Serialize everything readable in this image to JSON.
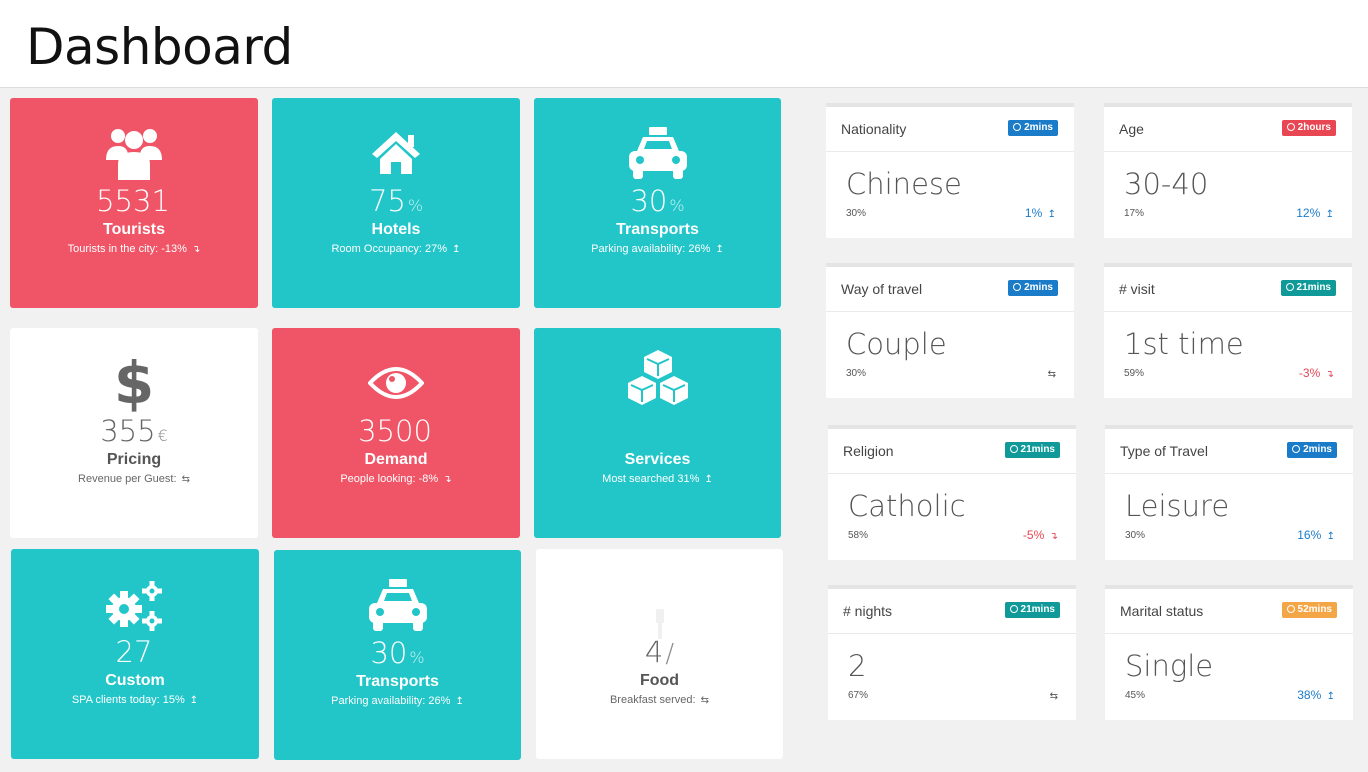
{
  "header": {
    "title": "Dashboard"
  },
  "tiles": [
    {
      "icon": "users-icon",
      "value": "5531",
      "unit": "",
      "label": "Tourists",
      "sub": "Tourists in the city: -13%",
      "trend": "down"
    },
    {
      "icon": "home-icon",
      "value": "75",
      "unit": "%",
      "label": "Hotels",
      "sub": "Room Occupancy: 27%",
      "trend": "up"
    },
    {
      "icon": "taxi-icon",
      "value": "30",
      "unit": "%",
      "label": "Transports",
      "sub": "Parking availability: 26%",
      "trend": "up"
    },
    {
      "icon": "dollar-icon",
      "value": "355",
      "unit": "€",
      "label": "Pricing",
      "sub": "Revenue per Guest:",
      "trend": "neutral"
    },
    {
      "icon": "eye-icon",
      "value": "3500",
      "unit": "",
      "label": "Demand",
      "sub": "People looking: -8%",
      "trend": "down"
    },
    {
      "icon": "cubes-icon",
      "value": "",
      "unit": "",
      "label": "Services",
      "sub": "Most searched 31%",
      "trend": "up"
    },
    {
      "icon": "gears-icon",
      "value": "27",
      "unit": "",
      "label": "Custom",
      "sub": "SPA clients today: 15%",
      "trend": "up"
    },
    {
      "icon": "taxi-icon",
      "value": "30",
      "unit": "%",
      "label": "Transports",
      "sub": "Parking availability: 26%",
      "trend": "up"
    },
    {
      "icon": "food-icon",
      "value": "4",
      "unit": "/",
      "label": "Food",
      "sub": "Breakfast served:",
      "trend": "neutral"
    }
  ],
  "cards": [
    {
      "title": "Nationality",
      "badge": "2mins",
      "badge_color": "blue",
      "value": "Chinese",
      "pct": "30%",
      "trend": "1%",
      "trend_dir": "up"
    },
    {
      "title": "Age",
      "badge": "2hours",
      "badge_color": "red",
      "value": "30-40",
      "pct": "17%",
      "trend": "12%",
      "trend_dir": "up"
    },
    {
      "title": "Way of travel",
      "badge": "2mins",
      "badge_color": "blue",
      "value": "Couple",
      "pct": "30%",
      "trend": "",
      "trend_dir": "neutral"
    },
    {
      "title": "# visit",
      "badge": "21mins",
      "badge_color": "teal",
      "value": "1st time",
      "pct": "59%",
      "trend": "-3%",
      "trend_dir": "down"
    },
    {
      "title": "Religion",
      "badge": "21mins",
      "badge_color": "teal",
      "value": "Catholic",
      "pct": "58%",
      "trend": "-5%",
      "trend_dir": "down"
    },
    {
      "title": "Type of Travel",
      "badge": "2mins",
      "badge_color": "blue",
      "value": "Leisure",
      "pct": "30%",
      "trend": "16%",
      "trend_dir": "up"
    },
    {
      "title": "# nights",
      "badge": "21mins",
      "badge_color": "teal",
      "value": "2",
      "pct": "67%",
      "trend": "",
      "trend_dir": "neutral"
    },
    {
      "title": "Marital status",
      "badge": "52mins",
      "badge_color": "orange",
      "value": "Single",
      "pct": "45%",
      "trend": "38%",
      "trend_dir": "up"
    }
  ],
  "colors": {
    "red": "#ef5566",
    "teal": "#22c6c9",
    "blue": "#1a7cc9",
    "orange": "#f4a546"
  }
}
